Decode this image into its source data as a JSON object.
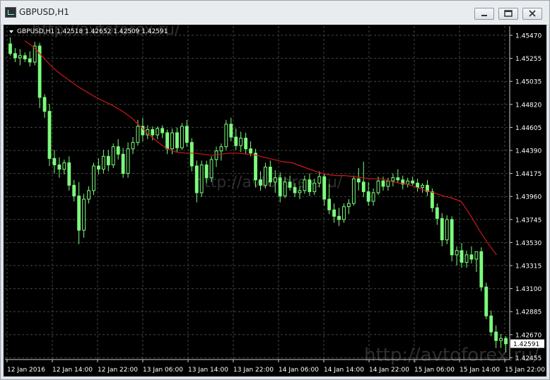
{
  "window": {
    "title": "GBPUSD,H1"
  },
  "header": {
    "symbol_line": "GBPUSD,H1  1.42518 1.42652 1.42509 1.42591"
  },
  "watermarks": [
    "http://avtoforex.ru/",
    "http://avtoforex.ru/",
    "http://avtoforex.ru/"
  ],
  "colors": {
    "background": "#000000",
    "grid": "#3a4a3a",
    "candle": "#7CFC7C",
    "ma": "#d01818",
    "axis_text": "#ffffff"
  },
  "chart_data": {
    "type": "candlestick",
    "symbol": "GBPUSD",
    "timeframe": "H1",
    "ohlc_last": {
      "open": 1.42518,
      "high": 1.42652,
      "low": 1.42509,
      "close": 1.42591
    },
    "current_price_label": "1.42591",
    "ylim": [
      1.4242,
      1.448
    ],
    "y_ticks": [
      "1.45470",
      "1.45255",
      "1.45035",
      "1.44820",
      "1.44605",
      "1.44390",
      "1.44175",
      "1.43960",
      "1.43745",
      "1.43530",
      "1.43315",
      "1.43100",
      "1.42885",
      "1.42670",
      "1.42455"
    ],
    "x_ticks": [
      "12 Jan 2016",
      "12 Jan 14:00",
      "12 Jan 22:00",
      "13 Jan 06:00",
      "13 Jan 14:00",
      "13 Jan 22:00",
      "14 Jan 06:00",
      "14 Jan 14:00",
      "14 Jan 22:00",
      "15 Jan 06:00",
      "15 Jan 14:00",
      "15 Jan 22:00"
    ],
    "grid": true,
    "candles": [
      [
        1.4539,
        1.4545,
        1.4528,
        1.453
      ],
      [
        1.453,
        1.4535,
        1.4522,
        1.4526
      ],
      [
        1.4526,
        1.4534,
        1.4519,
        1.4528
      ],
      [
        1.4528,
        1.4531,
        1.4522,
        1.4525
      ],
      [
        1.4525,
        1.4532,
        1.4518,
        1.4522
      ],
      [
        1.4522,
        1.4541,
        1.4519,
        1.4537
      ],
      [
        1.4537,
        1.454,
        1.4479,
        1.4489
      ],
      [
        1.4489,
        1.4492,
        1.447,
        1.4476
      ],
      [
        1.4476,
        1.4483,
        1.4425,
        1.4432
      ],
      [
        1.4432,
        1.444,
        1.4418,
        1.4426
      ],
      [
        1.4426,
        1.4433,
        1.4414,
        1.4422
      ],
      [
        1.4422,
        1.4431,
        1.4417,
        1.4428
      ],
      [
        1.4428,
        1.4434,
        1.4402,
        1.4407
      ],
      [
        1.4407,
        1.4412,
        1.4392,
        1.4397
      ],
      [
        1.4397,
        1.441,
        1.4352,
        1.4365
      ],
      [
        1.4365,
        1.4399,
        1.4358,
        1.4394
      ],
      [
        1.4394,
        1.4406,
        1.439,
        1.4402
      ],
      [
        1.4402,
        1.4428,
        1.4398,
        1.4425
      ],
      [
        1.4425,
        1.4432,
        1.4417,
        1.4422
      ],
      [
        1.4422,
        1.444,
        1.4418,
        1.4434
      ],
      [
        1.4434,
        1.444,
        1.442,
        1.4426
      ],
      [
        1.4426,
        1.4446,
        1.4423,
        1.4443
      ],
      [
        1.4443,
        1.445,
        1.4431,
        1.4436
      ],
      [
        1.4436,
        1.4442,
        1.4414,
        1.4418
      ],
      [
        1.4418,
        1.4447,
        1.4414,
        1.4441
      ],
      [
        1.4441,
        1.4452,
        1.4436,
        1.4447
      ],
      [
        1.4447,
        1.4468,
        1.4444,
        1.4462
      ],
      [
        1.4462,
        1.447,
        1.4448,
        1.4454
      ],
      [
        1.4454,
        1.4463,
        1.445,
        1.4459
      ],
      [
        1.4459,
        1.4462,
        1.4449,
        1.4454
      ],
      [
        1.4454,
        1.4462,
        1.445,
        1.446
      ],
      [
        1.446,
        1.4463,
        1.4451,
        1.4456
      ],
      [
        1.4456,
        1.4459,
        1.4436,
        1.4441
      ],
      [
        1.4441,
        1.446,
        1.4436,
        1.4456
      ],
      [
        1.4456,
        1.4461,
        1.4438,
        1.4442
      ],
      [
        1.4442,
        1.4465,
        1.444,
        1.4462
      ],
      [
        1.4462,
        1.4468,
        1.4443,
        1.4447
      ],
      [
        1.4447,
        1.4451,
        1.442,
        1.4425
      ],
      [
        1.4425,
        1.443,
        1.4391,
        1.44
      ],
      [
        1.44,
        1.443,
        1.4396,
        1.4426
      ],
      [
        1.4426,
        1.443,
        1.4409,
        1.4414
      ],
      [
        1.4414,
        1.4434,
        1.441,
        1.4431
      ],
      [
        1.4431,
        1.4443,
        1.4424,
        1.4439
      ],
      [
        1.4439,
        1.4446,
        1.443,
        1.4443
      ],
      [
        1.4443,
        1.4468,
        1.444,
        1.4464
      ],
      [
        1.4464,
        1.447,
        1.4448,
        1.4452
      ],
      [
        1.4452,
        1.446,
        1.444,
        1.4444
      ],
      [
        1.4444,
        1.4457,
        1.4438,
        1.4451
      ],
      [
        1.4451,
        1.4456,
        1.4436,
        1.4441
      ],
      [
        1.4441,
        1.4448,
        1.4434,
        1.4437
      ],
      [
        1.4437,
        1.4441,
        1.4405,
        1.4412
      ],
      [
        1.4412,
        1.442,
        1.4402,
        1.4407
      ],
      [
        1.4407,
        1.4428,
        1.4404,
        1.4424
      ],
      [
        1.4424,
        1.443,
        1.4406,
        1.441
      ],
      [
        1.441,
        1.4421,
        1.44,
        1.4414
      ],
      [
        1.4414,
        1.4419,
        1.4391,
        1.4397
      ],
      [
        1.4397,
        1.4415,
        1.4395,
        1.441
      ],
      [
        1.441,
        1.4416,
        1.4402,
        1.4405
      ],
      [
        1.4405,
        1.4409,
        1.4396,
        1.44
      ],
      [
        1.44,
        1.4406,
        1.4394,
        1.4402
      ],
      [
        1.4402,
        1.4416,
        1.4399,
        1.4412
      ],
      [
        1.4412,
        1.4418,
        1.4397,
        1.4401
      ],
      [
        1.4401,
        1.4413,
        1.4398,
        1.4409
      ],
      [
        1.4409,
        1.442,
        1.4405,
        1.4415
      ],
      [
        1.4415,
        1.4418,
        1.4388,
        1.4394
      ],
      [
        1.4394,
        1.4408,
        1.438,
        1.4384
      ],
      [
        1.4384,
        1.439,
        1.4372,
        1.4378
      ],
      [
        1.4378,
        1.4386,
        1.4369,
        1.4375
      ],
      [
        1.4375,
        1.439,
        1.4372,
        1.4387
      ],
      [
        1.4387,
        1.4394,
        1.438,
        1.439
      ],
      [
        1.439,
        1.4416,
        1.4388,
        1.4413
      ],
      [
        1.4413,
        1.4423,
        1.4402,
        1.441
      ],
      [
        1.441,
        1.4429,
        1.4396,
        1.4401
      ],
      [
        1.4401,
        1.441,
        1.4388,
        1.4392
      ],
      [
        1.4392,
        1.4404,
        1.4388,
        1.44
      ],
      [
        1.44,
        1.4415,
        1.4398,
        1.4411
      ],
      [
        1.4411,
        1.4415,
        1.4402,
        1.4406
      ],
      [
        1.4406,
        1.4414,
        1.4402,
        1.4411
      ],
      [
        1.4411,
        1.4418,
        1.4406,
        1.4414
      ],
      [
        1.4414,
        1.4422,
        1.4409,
        1.4412
      ],
      [
        1.4412,
        1.4416,
        1.4403,
        1.4408
      ],
      [
        1.4408,
        1.4414,
        1.4405,
        1.4411
      ],
      [
        1.4411,
        1.4415,
        1.4407,
        1.4409
      ],
      [
        1.4409,
        1.4413,
        1.4401,
        1.4405
      ],
      [
        1.4405,
        1.4409,
        1.44,
        1.4407
      ],
      [
        1.4407,
        1.4412,
        1.4397,
        1.4401
      ],
      [
        1.4401,
        1.4404,
        1.4382,
        1.4386
      ],
      [
        1.4386,
        1.439,
        1.437,
        1.4376
      ],
      [
        1.4376,
        1.4381,
        1.435,
        1.4356
      ],
      [
        1.4356,
        1.4379,
        1.4352,
        1.4375
      ],
      [
        1.4375,
        1.4378,
        1.4336,
        1.4342
      ],
      [
        1.4342,
        1.435,
        1.4332,
        1.4346
      ],
      [
        1.4346,
        1.4353,
        1.433,
        1.4335
      ],
      [
        1.4335,
        1.4346,
        1.433,
        1.4342
      ],
      [
        1.4342,
        1.435,
        1.4334,
        1.4338
      ],
      [
        1.4338,
        1.4345,
        1.4326,
        1.4345
      ],
      [
        1.4345,
        1.4349,
        1.4308,
        1.4312
      ],
      [
        1.4312,
        1.4316,
        1.4282,
        1.4285
      ],
      [
        1.4285,
        1.429,
        1.4266,
        1.427
      ],
      [
        1.427,
        1.4276,
        1.4255,
        1.4262
      ],
      [
        1.4262,
        1.4268,
        1.4255,
        1.4264
      ],
      [
        1.4264,
        1.4266,
        1.4251,
        1.4259
      ]
    ],
    "moving_average": [
      1.4542,
      1.4536,
      1.4527,
      1.4518,
      1.4511,
      1.4505,
      1.4499,
      1.4494,
      1.4489,
      1.4485,
      1.4481,
      1.4476,
      1.447,
      1.4462,
      1.4454,
      1.4447,
      1.4441,
      1.4438,
      1.4437,
      1.4437,
      1.4436,
      1.4435,
      1.4436,
      1.4437,
      1.4437,
      1.4436,
      1.4435,
      1.4433,
      1.4431,
      1.4429,
      1.4428,
      1.4425,
      1.4422,
      1.4419,
      1.4417,
      1.4416,
      1.4416,
      1.4415,
      1.4414,
      1.4413,
      1.4413,
      1.4411,
      1.4409,
      1.4408,
      1.4405,
      1.4402,
      1.44,
      1.4397,
      1.4395,
      1.4392,
      1.438,
      1.4366,
      1.4353,
      1.4342
    ]
  }
}
